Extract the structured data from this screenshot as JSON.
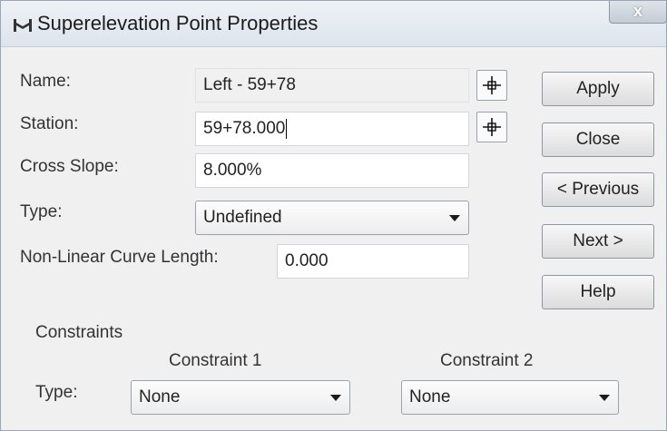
{
  "window": {
    "title": "Superelevation Point Properties",
    "close_glyph": "x"
  },
  "fields": {
    "name_label": "Name:",
    "name_value": "Left - 59+78",
    "station_label": "Station:",
    "station_value": "59+78.000",
    "cross_slope_label": "Cross Slope:",
    "cross_slope_value": "8.000%",
    "type_label": "Type:",
    "type_value": "Undefined",
    "nonlinear_label": "Non-Linear Curve Length:",
    "nonlinear_value": "0.000"
  },
  "buttons": {
    "apply": "Apply",
    "close": "Close",
    "previous": "< Previous",
    "next": "Next >",
    "help": "Help"
  },
  "constraints": {
    "group_label": "Constraints",
    "constraint1_label": "Constraint 1",
    "constraint2_label": "Constraint 2",
    "type_label": "Type:",
    "constraint1_type": "None",
    "constraint2_type": "None"
  },
  "icons": {
    "app": "road-profile-icon",
    "pick": "crosshair-pick-icon",
    "dropdown": "chevron-down-icon"
  }
}
